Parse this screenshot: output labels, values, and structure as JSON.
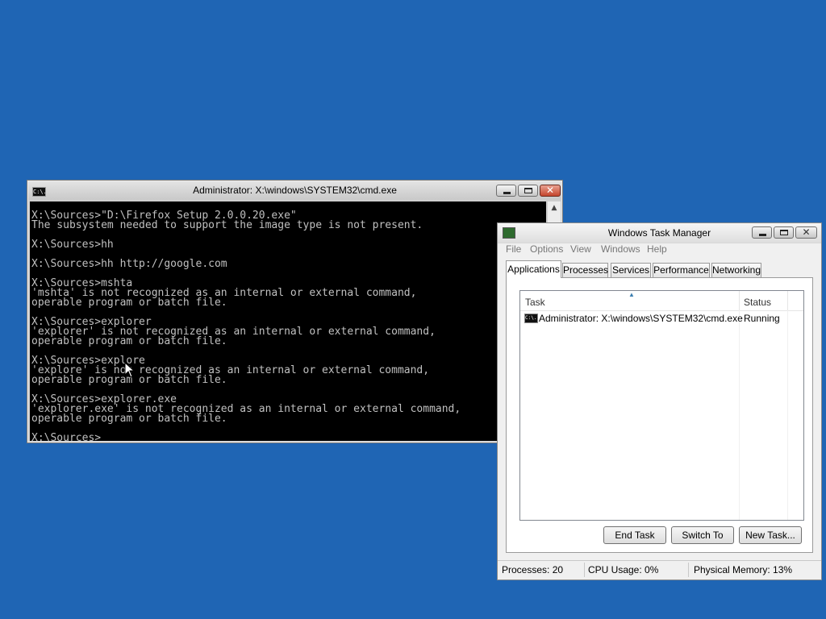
{
  "colors": {
    "desktop_background": "#1f65b4",
    "console_background": "#000000",
    "console_text": "#c0c0c0"
  },
  "cmd_window": {
    "title": "Administrator: X:\\windows\\SYSTEM32\\cmd.exe",
    "icon_text": "C:\\.",
    "lines": [
      "",
      "X:\\Sources>\"D:\\Firefox Setup 2.0.0.20.exe\"",
      "The subsystem needed to support the image type is not present.",
      "",
      "X:\\Sources>hh",
      "",
      "X:\\Sources>hh http://google.com",
      "",
      "X:\\Sources>mshta",
      "'mshta' is not recognized as an internal or external command,",
      "operable program or batch file.",
      "",
      "X:\\Sources>explorer",
      "'explorer' is not recognized as an internal or external command,",
      "operable program or batch file.",
      "",
      "X:\\Sources>explore",
      "'explore' is not recognized as an internal or external command,",
      "operable program or batch file.",
      "",
      "X:\\Sources>explorer.exe",
      "'explorer.exe' is not recognized as an internal or external command,",
      "operable program or batch file.",
      "",
      "X:\\Sources>"
    ]
  },
  "task_manager": {
    "title": "Windows Task Manager",
    "menu": [
      "File",
      "Options",
      "View",
      "Windows",
      "Help"
    ],
    "tabs": [
      "Applications",
      "Processes",
      "Services",
      "Performance",
      "Networking"
    ],
    "active_tab": "Applications",
    "columns": {
      "task": "Task",
      "status": "Status"
    },
    "tasks": [
      {
        "name": "Administrator: X:\\windows\\SYSTEM32\\cmd.exe",
        "status": "Running"
      }
    ],
    "buttons": {
      "end_task": "End Task",
      "switch_to": "Switch To",
      "new_task": "New Task..."
    },
    "status_bar": {
      "processes": "Processes: 20",
      "cpu": "CPU Usage: 0%",
      "memory": "Physical Memory: 13%"
    }
  }
}
